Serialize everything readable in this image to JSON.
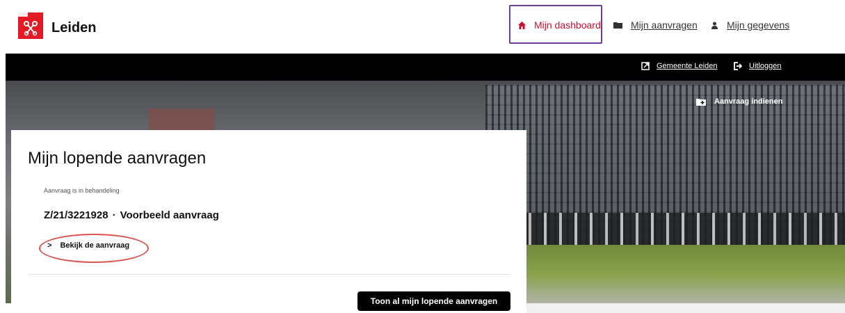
{
  "header": {
    "logo_text": "Leiden",
    "nav": {
      "dashboard": "Mijn dashboard",
      "aanvragen": "Mijn aanvragen",
      "gegevens": "Mijn gegevens"
    }
  },
  "topbar": {
    "gemeente": "Gemeente Leiden",
    "uitloggen": "Uitloggen"
  },
  "hero": {
    "aanvraag_indienen": "Aanvraag indienen"
  },
  "card": {
    "title": "Mijn lopende aanvragen",
    "status": "Aanvraag is in behandeling",
    "case_number": "Z/21/3221928",
    "separator": "·",
    "case_name": "Voorbeeld aanvraag",
    "view_link": "Bekijk de aanvraag",
    "all_button": "Toon al mijn lopende aanvragen"
  },
  "colors": {
    "brand_red": "#c8102e",
    "highlight_purple": "#6a3fa0",
    "annotation_red": "#d9534f"
  },
  "icons": {
    "dashboard": "home-icon",
    "aanvragen": "folder-icon",
    "gegevens": "user-icon",
    "gemeente": "external-link-icon",
    "uitloggen": "logout-icon",
    "aanvraag": "folder-plus-icon"
  }
}
